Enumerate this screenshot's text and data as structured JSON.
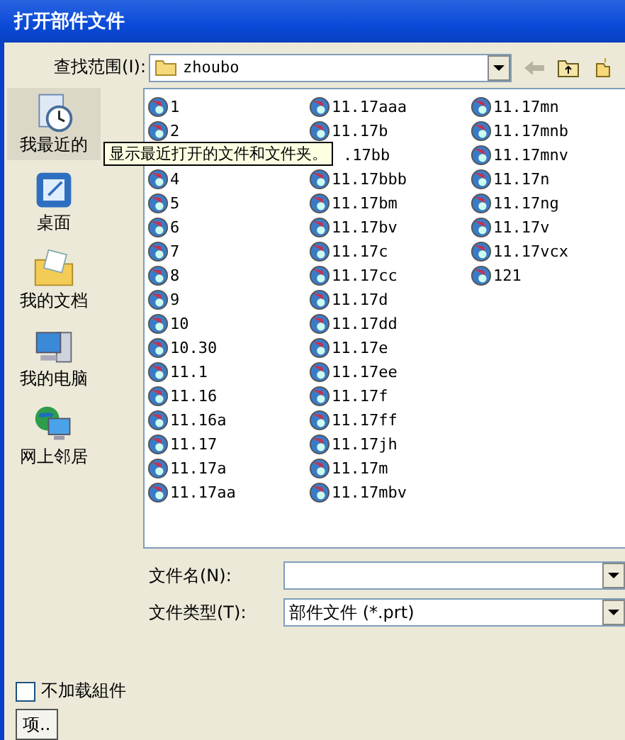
{
  "window": {
    "title": "打开部件文件"
  },
  "look_in": {
    "label": "查找范围(I):",
    "value": "zhoubo"
  },
  "places": [
    {
      "label": "我最近的"
    },
    {
      "label": "桌面"
    },
    {
      "label": "我的文档"
    },
    {
      "label": "我的电脑"
    },
    {
      "label": "网上邻居"
    }
  ],
  "tooltip": "显示最近打开的文件和文件夹。",
  "file_columns": [
    {
      "items": [
        {
          "name": "1",
          "kind": "file"
        },
        {
          "name": "2",
          "kind": "file"
        },
        {
          "name": "4",
          "kind": "file"
        },
        {
          "name": "5",
          "kind": "file"
        },
        {
          "name": "6",
          "kind": "file"
        },
        {
          "name": "7",
          "kind": "file"
        },
        {
          "name": "8",
          "kind": "file"
        },
        {
          "name": "9",
          "kind": "file"
        },
        {
          "name": "10",
          "kind": "file"
        },
        {
          "name": "10.30",
          "kind": "file"
        },
        {
          "name": "11.1",
          "kind": "file"
        },
        {
          "name": "11.16",
          "kind": "file"
        },
        {
          "name": "11.16a",
          "kind": "file"
        },
        {
          "name": "11.17",
          "kind": "file"
        },
        {
          "name": "11.17a",
          "kind": "file"
        },
        {
          "name": "11.17aa",
          "kind": "file"
        }
      ]
    },
    {
      "items": [
        {
          "name": "11.17aaa",
          "kind": "file"
        },
        {
          "name": "11.17b",
          "kind": "file"
        },
        {
          "name": ".17bb",
          "kind": "covered"
        },
        {
          "name": "11.17bbb",
          "kind": "file"
        },
        {
          "name": "11.17bm",
          "kind": "file"
        },
        {
          "name": "11.17bv",
          "kind": "file"
        },
        {
          "name": "11.17c",
          "kind": "file"
        },
        {
          "name": "11.17cc",
          "kind": "file"
        },
        {
          "name": "11.17d",
          "kind": "file"
        },
        {
          "name": "11.17dd",
          "kind": "file"
        },
        {
          "name": "11.17e",
          "kind": "file"
        },
        {
          "name": "11.17ee",
          "kind": "file"
        },
        {
          "name": "11.17f",
          "kind": "file"
        },
        {
          "name": "11.17ff",
          "kind": "file"
        },
        {
          "name": "11.17jh",
          "kind": "file"
        },
        {
          "name": "11.17m",
          "kind": "file"
        },
        {
          "name": "11.17mbv",
          "kind": "file"
        }
      ]
    },
    {
      "items": [
        {
          "name": "11.17mn",
          "kind": "file"
        },
        {
          "name": "11.17mnb",
          "kind": "file"
        },
        {
          "name": "11.17mnv",
          "kind": "file"
        },
        {
          "name": "11.17n",
          "kind": "file"
        },
        {
          "name": "11.17ng",
          "kind": "file"
        },
        {
          "name": "11.17v",
          "kind": "file"
        },
        {
          "name": "11.17vcx",
          "kind": "file"
        },
        {
          "name": "121",
          "kind": "file"
        }
      ]
    }
  ],
  "file_name": {
    "label": "文件名(N):"
  },
  "file_type": {
    "label": "文件类型(T):",
    "value": "部件文件 (*.prt)"
  },
  "no_load_components": {
    "label": "不加载組件",
    "checked": false
  },
  "options_button": "项.."
}
